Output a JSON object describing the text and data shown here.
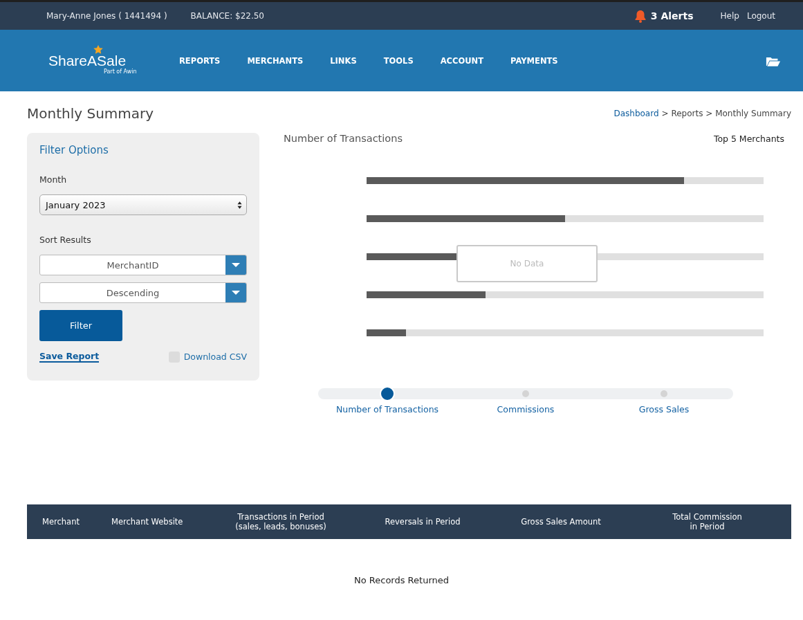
{
  "top_bar": {
    "user": "Mary-Anne Jones ( 1441494 )",
    "balance": "BALANCE: $22.50",
    "alerts": "3 Alerts",
    "links": [
      "Help",
      "Logout"
    ]
  },
  "header": {
    "logo": "ShareASale",
    "logo_tagline": "Part of Awin",
    "nav": [
      "REPORTS",
      "MERCHANTS",
      "LINKS",
      "TOOLS",
      "ACCOUNT",
      "PAYMENTS"
    ]
  },
  "page_title": "Monthly Summary",
  "breadcrumb": {
    "link": "Dashboard",
    "rest": "> Reports > Monthly Summary"
  },
  "filter_panel": {
    "title": "Filter Options",
    "month_label": "Month",
    "month_value": "January 2023",
    "sort_label": "Sort Results",
    "sort_selects": [
      "MerchantID",
      "Descending"
    ],
    "filter_button": "Filter",
    "save_report": "Save Report",
    "download_csv": {
      "label": "Download CSV",
      "checked": false
    }
  },
  "chart_panel": {
    "title": "Number of Transactions",
    "subtitle": "Top 5 Merchants",
    "placeholder_bars": [
      {
        "level": 0.8
      },
      {
        "level": 0.5
      },
      {
        "level": 0.23
      },
      {
        "level": 0.3
      },
      {
        "level": 0.1
      }
    ],
    "no_data": "No Data",
    "metric_tabs": [
      {
        "label": "Number of Transactions",
        "selected": true
      },
      {
        "label": "Commissions",
        "selected": false
      },
      {
        "label": "Gross Sales",
        "selected": false
      }
    ]
  },
  "table": {
    "columns": [
      "Merchant",
      "Merchant Website",
      "Transactions in Period\n(sales, leads, bonuses)",
      "Reversals in Period",
      "Gross Sales Amount",
      "Total Commission\nin Period"
    ],
    "empty_message": "No Records Returned"
  }
}
